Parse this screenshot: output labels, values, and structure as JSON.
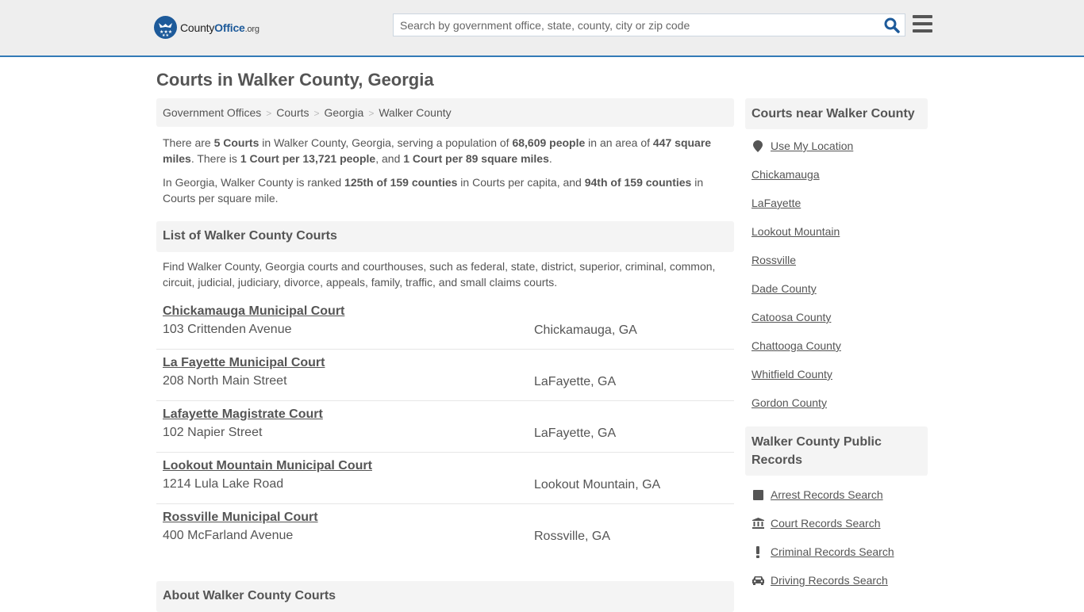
{
  "header": {
    "logo": {
      "text_main": "County",
      "text_brand": "Office",
      "text_tld": ".org"
    },
    "search": {
      "placeholder": "Search by government office, state, county, city or zip code",
      "value": ""
    },
    "colors": {
      "accent": "#337ab7",
      "brand": "#1d5a9a",
      "background": "#eeeeee"
    }
  },
  "page": {
    "title": "Courts in Walker County, Georgia",
    "breadcrumb": [
      "Government Offices",
      "Courts",
      "Georgia",
      "Walker County"
    ]
  },
  "intro": {
    "p1": {
      "t1": "There are ",
      "b1": "5 Courts",
      "t2": " in Walker County, Georgia, serving a population of ",
      "b2": "68,609 people",
      "t3": " in an area of ",
      "b3": "447 square miles",
      "t4": ". There is ",
      "b4": "1 Court per 13,721 people",
      "t5": ", and ",
      "b5": "1 Court per 89 square miles",
      "t6": "."
    },
    "p2": {
      "t1": "In Georgia, Walker County is ranked ",
      "b1": "125th of 159 counties",
      "t2": " in Courts per capita, and ",
      "b2": "94th of 159 counties",
      "t3": " in Courts per square mile."
    }
  },
  "list": {
    "heading": "List of Walker County Courts",
    "description": "Find Walker County, Georgia courts and courthouses, such as federal, state, district, superior, criminal, common, circuit, judicial, judiciary, divorce, appeals, family, traffic, and small claims courts.",
    "courts": [
      {
        "name": "Chickamauga Municipal Court",
        "address": "103 Crittenden Avenue",
        "city": "Chickamauga, GA"
      },
      {
        "name": "La Fayette Municipal Court",
        "address": "208 North Main Street",
        "city": "LaFayette, GA"
      },
      {
        "name": "Lafayette Magistrate Court",
        "address": "102 Napier Street",
        "city": "LaFayette, GA"
      },
      {
        "name": "Lookout Mountain Municipal Court",
        "address": "1214 Lula Lake Road",
        "city": "Lookout Mountain, GA"
      },
      {
        "name": "Rossville Municipal Court",
        "address": "400 McFarland Avenue",
        "city": "Rossville, GA"
      }
    ]
  },
  "about": {
    "heading": "About Walker County Courts"
  },
  "sidebar": {
    "nearby": {
      "heading": "Courts near Walker County",
      "use_location": {
        "label": "Use My Location",
        "icon": "map-marker-icon"
      },
      "links": [
        "Chickamauga",
        "LaFayette",
        "Lookout Mountain",
        "Rossville",
        "Dade County",
        "Catoosa County",
        "Chattooga County",
        "Whitfield County",
        "Gordon County"
      ]
    },
    "records": {
      "heading": "Walker County Public Records",
      "links": [
        {
          "label": "Arrest Records Search",
          "icon": "square-icon"
        },
        {
          "label": "Court Records Search",
          "icon": "courthouse-icon"
        },
        {
          "label": "Criminal Records Search",
          "icon": "exclamation-icon"
        },
        {
          "label": "Driving Records Search",
          "icon": "car-icon"
        }
      ]
    }
  }
}
